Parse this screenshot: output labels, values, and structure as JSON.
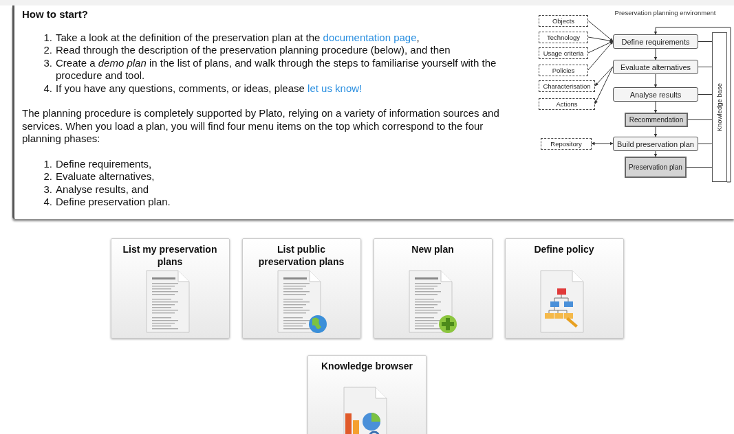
{
  "intro": {
    "heading": "How to start?",
    "step_markers": [
      "1.",
      "2.",
      "3.",
      "4."
    ],
    "phase_markers": [
      "1.",
      "2.",
      "3.",
      "4."
    ],
    "steps": [
      [
        {
          "kind": "text",
          "text": "Take a look at the definition of the preservation plan at the "
        },
        {
          "kind": "link",
          "text": "documentation page"
        },
        {
          "kind": "text",
          "text": ","
        }
      ],
      [
        {
          "kind": "text",
          "text": "Read through the description of the preservation planning procedure (below), and then"
        }
      ],
      [
        {
          "kind": "text",
          "text": "Create a *demo plan* in the list of plans, and walk through the steps to familiarise yourself with the procedure and tool."
        }
      ],
      [
        {
          "kind": "text",
          "text": "If you have any questions, comments, or ideas, please "
        },
        {
          "kind": "link",
          "text": "let us know!"
        }
      ]
    ],
    "paragraph": "The planning procedure is completely supported by Plato, relying on a variety of information sources and services. When you load a plan, you will find four menu items on the top which correspond to the four planning phases:",
    "phases": [
      "Define requirements,",
      "Evaluate alternatives,",
      "Analyse results, and",
      "Define preservation plan."
    ]
  },
  "diagram": {
    "title": "Preservation planning environment",
    "inputs": [
      "Objects",
      "Technology",
      "Usage criteria",
      "Policies",
      "Characterisation",
      "Actions"
    ],
    "steps": [
      {
        "label": "Define requirements",
        "kind": "activity"
      },
      {
        "label": "Evaluate alternatives",
        "kind": "activity"
      },
      {
        "label": "Analyse results",
        "kind": "activity"
      },
      {
        "label": "Recommendation",
        "kind": "result"
      },
      {
        "label": "Build preservation plan",
        "kind": "activity"
      },
      {
        "label": "Preservation plan",
        "kind": "result"
      }
    ],
    "repository": "Repository",
    "knowledge_base": "Knowledge base"
  },
  "tiles": [
    {
      "label": "List my preservation plans",
      "kind": "document"
    },
    {
      "label": "List public preservation plans",
      "kind": "shared"
    },
    {
      "label": "New plan",
      "kind": "create"
    },
    {
      "label": "Define policy",
      "kind": "policy"
    },
    {
      "label": "Knowledge browser",
      "kind": "knowledge"
    }
  ]
}
